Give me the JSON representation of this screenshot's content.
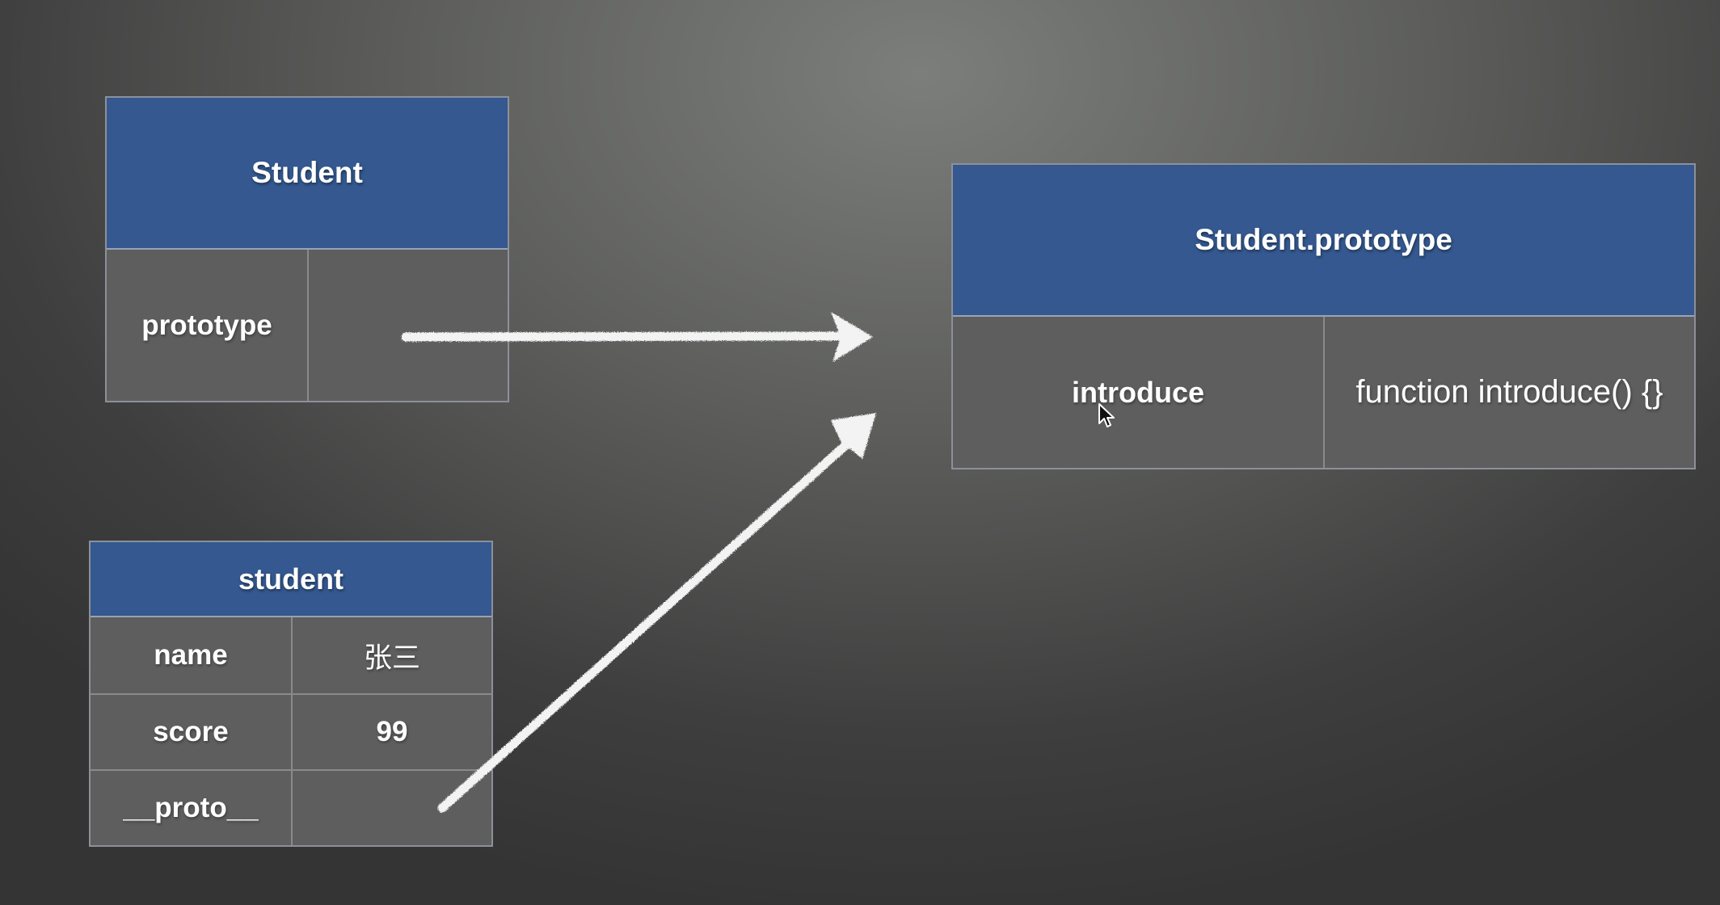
{
  "student_constructor": {
    "title": "Student",
    "rows": [
      {
        "key": "prototype",
        "value": ""
      }
    ]
  },
  "student_prototype": {
    "title": "Student.prototype",
    "rows": [
      {
        "key": "introduce",
        "value": "function introduce() {}"
      }
    ]
  },
  "student_instance": {
    "title": "student",
    "rows": [
      {
        "key": "name",
        "value": "张三"
      },
      {
        "key": "score",
        "value": "99"
      },
      {
        "key": "__proto__",
        "value": ""
      }
    ]
  },
  "colors": {
    "header": "#34588f",
    "cell": "#5e5e5e",
    "arrow": "#f4f4f4"
  }
}
